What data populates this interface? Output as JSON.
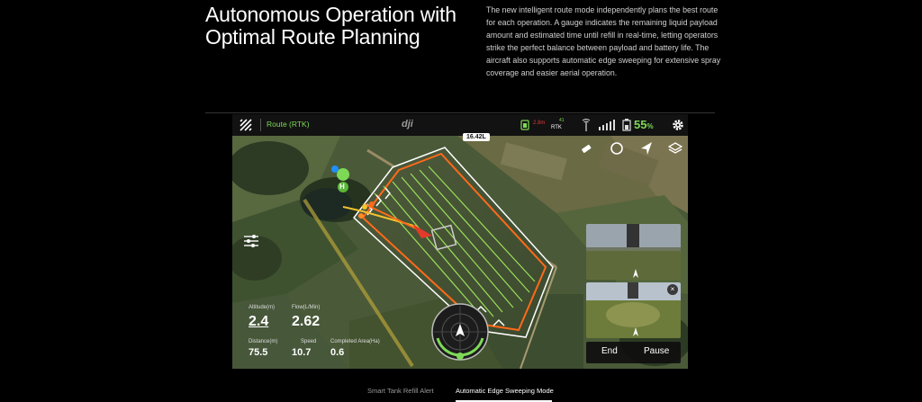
{
  "section": {
    "headline": "Autonomous Operation with Optimal Route Planning",
    "description": "The new intelligent route mode independently plans the best route for each operation. A gauge indicates the remaining liquid payload amount and estimated time until refill in real-time, letting operators strike the perfect balance between payload and battery life. The aircraft also supports automatic edge sweeping for extensive spray coverage and easier aerial operation."
  },
  "app": {
    "route_label": "Route (RTK)",
    "brand": "dji",
    "status": {
      "rtk_sub": "2.8m",
      "rtk_label": "RTK",
      "sat_count": "41",
      "battery_percent": "55",
      "battery_unit": "%"
    },
    "payload_remaining": "16.42L",
    "telemetry": {
      "altitude_label": "Altitude(m)",
      "altitude_value": "2.4",
      "flow_label": "Flow(L/Min)",
      "flow_value": "2.62",
      "distance_label": "Distance(m)",
      "distance_value": "75.5",
      "speed_label": "Speed",
      "speed_value": "10.7",
      "area_label": "Completed Area(Ha)",
      "area_value": "0.6"
    },
    "home_marker": "H",
    "actions": {
      "end_label": "End",
      "pause_label": "Pause"
    },
    "close_symbol": "×",
    "colors": {
      "accent_green": "#7ed957",
      "route_orange": "#ff6a1a",
      "route_yellow": "#f2c230"
    }
  },
  "tabs": [
    {
      "label": "Smart Tank Refill Alert",
      "active": false
    },
    {
      "label": "Automatic Edge Sweeping Mode",
      "active": true
    }
  ]
}
